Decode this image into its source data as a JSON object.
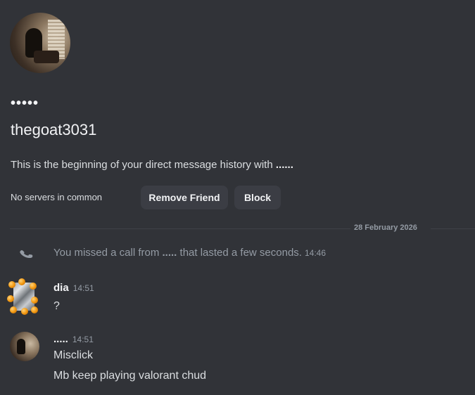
{
  "profile": {
    "display_name": "•••••",
    "username": "thegoat3031",
    "intro_prefix": "This is the beginning of your direct message history with ",
    "intro_name": "......",
    "mutual_servers": "No servers in common",
    "remove_friend_label": "Remove Friend",
    "block_label": "Block"
  },
  "divider": {
    "date": "28 February 2026"
  },
  "call": {
    "prefix": "You missed a call from ",
    "caller": ".....",
    "suffix": " that lasted a few seconds.",
    "time": "14:46",
    "icon": "missed-call-icon"
  },
  "messages": [
    {
      "author": "dia",
      "time": "14:51",
      "lines": [
        "?"
      ]
    },
    {
      "author": ".....",
      "time": "14:51",
      "lines": [
        "Misclick",
        "Mb keep playing valorant chud"
      ]
    }
  ],
  "colors": {
    "background": "#313338",
    "button": "#3b3d44",
    "muted_text": "#949ba4",
    "text": "#dbdee1",
    "heading": "#f2f3f5"
  }
}
